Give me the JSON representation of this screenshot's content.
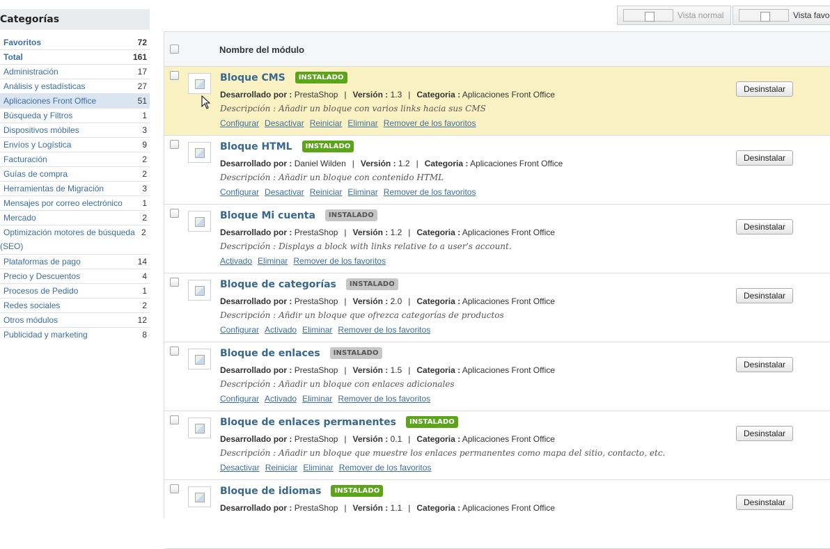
{
  "sidebar": {
    "title": "Categorías",
    "categories": [
      {
        "label": "Favoritos",
        "count": "72"
      },
      {
        "label": "Total",
        "count": "161"
      },
      {
        "label": "Administración",
        "count": "17"
      },
      {
        "label": "Análisis y estadísticas",
        "count": "27"
      },
      {
        "label": "Aplicaciones Front Office",
        "count": "51"
      },
      {
        "label": "Búsqueda y Filtros",
        "count": "1"
      },
      {
        "label": "Dispositivos móbiles",
        "count": "3"
      },
      {
        "label": "Envíos y Logística",
        "count": "9"
      },
      {
        "label": "Facturación",
        "count": "2"
      },
      {
        "label": "Guías de compra",
        "count": "2"
      },
      {
        "label": "Herramientas de Migración",
        "count": "3"
      },
      {
        "label": "Mensajes por correo electrónico",
        "count": "1"
      },
      {
        "label": "Mercado",
        "count": "2"
      },
      {
        "label": "Optimización motores de búsqueda",
        "label2": "(SEO)",
        "count": "2"
      },
      {
        "label": "Plataformas de pago",
        "count": "14"
      },
      {
        "label": "Precio y Descuentos",
        "count": "4"
      },
      {
        "label": "Procesos de Pedido",
        "count": "1"
      },
      {
        "label": "Redes sociales",
        "count": "2"
      },
      {
        "label": "Otros módulos",
        "count": "12"
      },
      {
        "label": "Publicidad y marketing",
        "count": "8"
      }
    ]
  },
  "toolbar": {
    "normal_view_label": "Vista normal",
    "fav_view_label": "Vista favo"
  },
  "table": {
    "header_title": "Nombre del módulo",
    "labels": {
      "dev": "Desarrollado por :",
      "version": "Versión :",
      "category": "Categoria :",
      "desc_prefix": "Descripción :",
      "uninstall": "Desinstalar"
    },
    "modules": [
      {
        "name": "Bloque CMS",
        "badge": "INSTALADO",
        "badge_style": "green",
        "dev": "PrestaShop",
        "version": "1.3",
        "category": "Aplicaciones Front Office",
        "description": "Añadir un bloque con varios links hacia sus CMS",
        "links": [
          "Configurar",
          "Desactivar",
          "Reiniciar",
          "Eliminar",
          "Remover de los favoritos"
        ]
      },
      {
        "name": "Bloque HTML",
        "badge": "INSTALADO",
        "badge_style": "green",
        "dev": "Daniel Wilden",
        "version": "1.2",
        "category": "Aplicaciones Front Office",
        "description": "Añadir un bloque con contenido HTML",
        "links": [
          "Configurar",
          "Desactivar",
          "Reiniciar",
          "Eliminar",
          "Remover de los favoritos"
        ]
      },
      {
        "name": "Bloque Mi cuenta",
        "badge": "INSTALADO",
        "badge_style": "gray",
        "dev": "PrestaShop",
        "version": "1.2",
        "category": "Aplicaciones Front Office",
        "description": "Displays a block with links relative to a user's account.",
        "links": [
          "Activado",
          "Eliminar",
          "Remover de los favoritos"
        ]
      },
      {
        "name": "Bloque de categorías",
        "badge": "INSTALADO",
        "badge_style": "gray",
        "dev": "PrestaShop",
        "version": "2.0",
        "category": "Aplicaciones Front Office",
        "description": "Añdir un bloque que ofrezca categorías de productos",
        "links": [
          "Configurar",
          "Activado",
          "Eliminar",
          "Remover de los favoritos"
        ]
      },
      {
        "name": "Bloque de enlaces",
        "badge": "INSTALADO",
        "badge_style": "gray",
        "dev": "PrestaShop",
        "version": "1.5",
        "category": "Aplicaciones Front Office",
        "description": "Añadir un bloque con enlaces adicionales",
        "links": [
          "Configurar",
          "Activado",
          "Eliminar",
          "Remover de los favoritos"
        ]
      },
      {
        "name": "Bloque de enlaces permanentes",
        "badge": "INSTALADO",
        "badge_style": "green",
        "dev": "PrestaShop",
        "version": "0.1",
        "category": "Aplicaciones Front Office",
        "description": "Añadir un bloque que muestre los enlaces permanentes como mapa del sitio, contacto, etc.",
        "links": [
          "Desactivar",
          "Reiniciar",
          "Eliminar",
          "Remover de los favoritos"
        ]
      },
      {
        "name": "Bloque de idiomas",
        "badge": "INSTALADO",
        "badge_style": "green",
        "dev": "PrestaShop",
        "version": "1.1",
        "category": "Aplicaciones Front Office",
        "description": "",
        "links": []
      }
    ]
  }
}
